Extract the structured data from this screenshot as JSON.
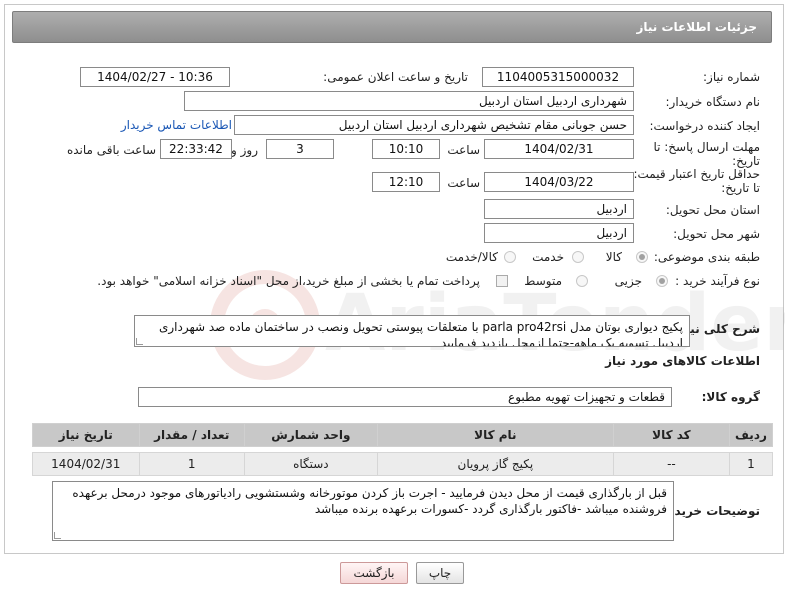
{
  "page": {
    "title": "جزئیات اطلاعات نیاز"
  },
  "form": {
    "need_number_label": "شماره نیاز:",
    "need_number": "1104005315000032",
    "announce_label": "تاریخ و ساعت اعلان عمومی:",
    "announce_value": "1404/02/27 - 10:36",
    "buyer_org_label": "نام دستگاه خریدار:",
    "buyer_org": "شهرداری اردبیل استان اردبیل",
    "creator_label": "ایجاد کننده درخواست:",
    "creator": "حسن جوبانی مقام تشخیص شهرداری اردبیل استان اردبیل",
    "contact_link": "اطلاعات تماس خریدار",
    "deadline_label_1": "مهلت ارسال پاسخ: تا",
    "deadline_label_2": "تاریخ:",
    "deadline_date": "1404/02/31",
    "time_label": "ساعت",
    "deadline_time": "10:10",
    "days_value": "3",
    "days_label": "روز و",
    "remaining_time": "22:33:42",
    "remaining_label": "ساعت باقی مانده",
    "validity_label_1": "حداقل تاریخ اعتبار قیمت:",
    "validity_label_2": "تا تاریخ:",
    "validity_date": "1404/03/22",
    "validity_time_label": "ساعت",
    "validity_time": "12:10",
    "province_label": "استان محل تحویل:",
    "province": "اردبیل",
    "city_label": "شهر محل تحویل:",
    "city": "اردبیل",
    "category_label": "طبقه بندی موضوعی:",
    "category_options": [
      "کالا",
      "خدمت",
      "کالا/خدمت"
    ],
    "process_label": "نوع فرآیند خرید :",
    "process_options": [
      "جزیی",
      "متوسط"
    ],
    "payment_note": "پرداخت تمام یا بخشی از مبلغ خرید،از محل \"اسناد خزانه اسلامی\" خواهد بود.",
    "description_label": "شرح کلی نیاز:",
    "description": "پکیج دیواری بوتان مدل parla pro42rsi با متعلقات پیوستی تحویل ونصب در ساختمان ماده صد شهرداری اردبیل تسویه یک ماهه-حتما ازمحل بازدید فرمایید",
    "goods_info_title": "اطلاعات کالاهای مورد نیاز",
    "goods_group_label": "گروه کالا:",
    "goods_group": "قطعات و تجهیزات تهویه مطبوع",
    "buyer_notes_label": "توضیحات خریدار:",
    "buyer_notes": "قبل از بارگذاری قیمت از محل دیدن فرمایید - اجرت باز کردن موتورخانه وشستشویی رادیاتورهای موجود درمحل برعهده فروشنده میباشد -فاکتور بارگذاری گردد -کسورات برعهده برنده میباشد"
  },
  "table": {
    "headers": [
      "ردیف",
      "کد کالا",
      "نام کالا",
      "واحد شمارش",
      "تعداد / مقدار",
      "تاریخ نیاز"
    ],
    "rows": [
      [
        "1",
        "--",
        "پکیج گاز پرویان",
        "دستگاه",
        "1",
        "1404/02/31"
      ]
    ]
  },
  "buttons": {
    "print": "چاپ",
    "back": "بازگشت"
  },
  "watermark": {
    "text": "AriaTender.neT"
  }
}
